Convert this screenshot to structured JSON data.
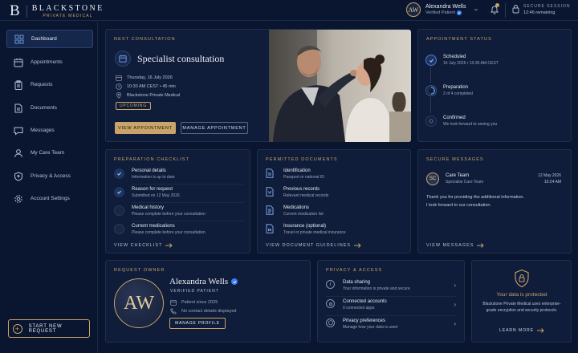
{
  "brand": {
    "mark": "B",
    "name": "BLACKSTONE",
    "tagline": "PRIVATE MEDICAL"
  },
  "user": {
    "initials": "AW",
    "name": "Alexandra Wells",
    "status": "Verified Patient"
  },
  "session": {
    "label": "SECURE SESSION",
    "time": "12:46 remaining"
  },
  "sidebar": {
    "items": [
      {
        "label": "Dashboard",
        "icon": "dashboard-icon",
        "active": true
      },
      {
        "label": "Appointments",
        "icon": "calendar-icon"
      },
      {
        "label": "Requests",
        "icon": "clipboard-icon"
      },
      {
        "label": "Documents",
        "icon": "document-icon"
      },
      {
        "label": "Messages",
        "icon": "message-icon"
      },
      {
        "label": "My Care Team",
        "icon": "user-icon"
      },
      {
        "label": "Privacy & Access",
        "icon": "shield-icon"
      },
      {
        "label": "Account Settings",
        "icon": "gear-icon"
      }
    ],
    "new_request": "START NEW REQUEST"
  },
  "consultation": {
    "section": "NEXT CONSULTATION",
    "title": "Specialist consultation",
    "date": "Thursday, 16 July 2026",
    "time": "10:30 AM CEST  •  45 min",
    "location": "Blackstone Private Medical",
    "badge": "UPCOMING",
    "view_btn": "VIEW APPOINTMENT",
    "manage_btn": "MANAGE APPOINTMENT"
  },
  "appointment_status": {
    "section": "APPOINTMENT STATUS",
    "steps": [
      {
        "name": "Scheduled",
        "sub": "16 July 2026  •  10:30 AM CEST"
      },
      {
        "name": "Preparation",
        "sub": "2 of 4 completed"
      },
      {
        "name": "Confirmed",
        "sub": "We look forward to seeing you"
      }
    ]
  },
  "checklist": {
    "section": "PREPARATION CHECKLIST",
    "items": [
      {
        "title": "Personal details",
        "sub": "Information is up to date",
        "done": true
      },
      {
        "title": "Reason for request",
        "sub": "Submitted on 12 May 2026",
        "done": true
      },
      {
        "title": "Medical history",
        "sub": "Please complete before your consultation",
        "done": false
      },
      {
        "title": "Current medications",
        "sub": "Please complete before your consultation",
        "done": false
      }
    ],
    "link": "VIEW CHECKLIST"
  },
  "documents": {
    "section": "PERMITTED DOCUMENTS",
    "items": [
      {
        "title": "Identification",
        "sub": "Passport or national ID"
      },
      {
        "title": "Previous records",
        "sub": "Relevant medical records"
      },
      {
        "title": "Medications",
        "sub": "Current medication list"
      },
      {
        "title": "Insurance (optional)",
        "sub": "Travel or private medical insurance"
      }
    ],
    "link": "VIEW DOCUMENT GUIDELINES"
  },
  "messages": {
    "section": "SECURE MESSAGES",
    "initials": "SC",
    "sender": "Care Team",
    "role": "Specialist Care Team",
    "date": "12 May 2026",
    "time": "10:24 AM",
    "line1": "Thank you for providing the additional information.",
    "line2": "I look forward to our consultation.",
    "link": "VIEW MESSAGES"
  },
  "owner": {
    "section": "REQUEST OWNER",
    "initials": "AW",
    "name": "Alexandra Wells",
    "verified": "VERIFIED PATIENT",
    "since": "Patient since 2025",
    "contact": "No contact details displayed",
    "manage": "MANAGE PROFILE"
  },
  "privacy": {
    "section": "PRIVACY & ACCESS",
    "items": [
      {
        "title": "Data sharing",
        "sub": "Your information is private and secure",
        "icon": "info-icon"
      },
      {
        "title": "Connected accounts",
        "sub": "0 connected apps",
        "icon": "link-icon"
      },
      {
        "title": "Privacy preferences",
        "sub": "Manage how your data is used",
        "icon": "shield-icon"
      }
    ]
  },
  "protected": {
    "title": "Your data is protected",
    "text": "Blackstone Private Medical uses enterprise-grade encryption and security protocols.",
    "link": "LEARN MORE"
  }
}
